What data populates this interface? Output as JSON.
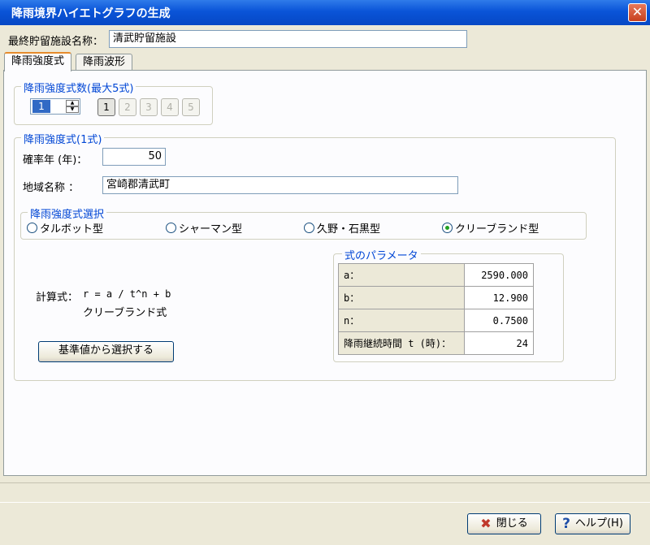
{
  "window": {
    "title": "降雨境界ハイエトグラフの生成",
    "close_label": "✕"
  },
  "facility": {
    "label": "最終貯留施設名称：",
    "value": "清武貯留施設"
  },
  "tabs": [
    {
      "label": "降雨強度式"
    },
    {
      "label": "降雨波形"
    }
  ],
  "count_group": {
    "legend": "降雨強度式数(最大5式)",
    "spinner_value": "1",
    "buttons": [
      "1",
      "2",
      "3",
      "4",
      "5"
    ],
    "selected": "1"
  },
  "formula_group": {
    "legend": "降雨強度式(1式)",
    "year_label": "確率年 (年)：",
    "year_value": "50",
    "region_label": "地域名称 ：",
    "region_value": "宮崎郡清武町"
  },
  "selection_group": {
    "legend": "降雨強度式選択",
    "options": [
      "タルボット型",
      "シャーマン型",
      "久野・石黒型",
      "クリーブランド型"
    ],
    "selected": "クリーブランド型"
  },
  "calc": {
    "label": "計算式：",
    "formula": "r = a / t^n + b",
    "name": "クリーブランド式"
  },
  "select_button": "基準値から選択する",
  "params": {
    "legend": "式のパラメータ",
    "rows": [
      {
        "key": "a：",
        "value": "2590.000"
      },
      {
        "key": "b：",
        "value": "12.900"
      },
      {
        "key": "n：",
        "value": "0.7500"
      },
      {
        "key": "降雨継続時間 t (時)：",
        "value": "24"
      }
    ]
  },
  "footer": {
    "close_button": "閉じる",
    "help_button": "ヘルプ(H)"
  },
  "colors": {
    "title_bar": "#0a54d8",
    "legend_text": "#0046d5",
    "close_icon": "#c0392b",
    "help_icon": "#1f4fa8"
  }
}
